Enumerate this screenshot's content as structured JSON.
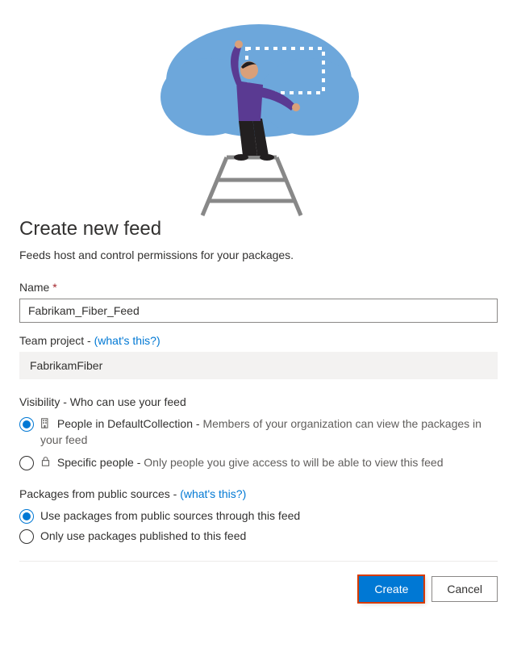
{
  "title": "Create new feed",
  "subtitle": "Feeds host and control permissions for your packages.",
  "name": {
    "label": "Name",
    "required_marker": "*",
    "value": "Fabrikam_Fiber_Feed"
  },
  "team_project": {
    "label": "Team project -",
    "help_link": "(what's this?)",
    "value": "FabrikamFiber"
  },
  "visibility": {
    "label": "Visibility - Who can use your feed",
    "options": [
      {
        "prefix": "People in DefaultCollection -",
        "desc": "Members of your organization can view the packages in your feed",
        "checked": true,
        "icon": "org-icon"
      },
      {
        "prefix": "Specific people -",
        "desc": "Only people you give access to will be able to view this feed",
        "checked": false,
        "icon": "lock-icon"
      }
    ]
  },
  "public_sources": {
    "label": "Packages from public sources -",
    "help_link": "(what's this?)",
    "options": [
      {
        "label": "Use packages from public sources through this feed",
        "checked": true
      },
      {
        "label": "Only use packages published to this feed",
        "checked": false
      }
    ]
  },
  "footer": {
    "create": "Create",
    "cancel": "Cancel"
  }
}
